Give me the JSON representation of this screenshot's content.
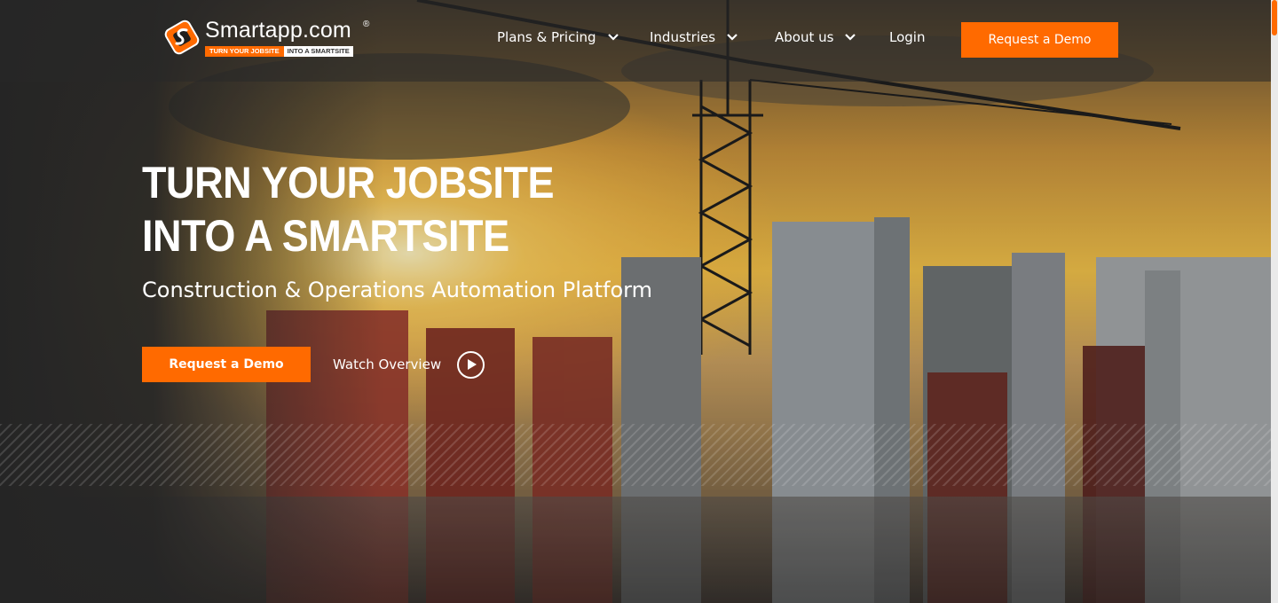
{
  "brand": {
    "name": "Smartapp.com",
    "registered": "®",
    "tagline_left": "TURN YOUR JOBSITE",
    "tagline_right": "INTO A SMARTSITE",
    "accent": "#ff6a00"
  },
  "nav": {
    "items": [
      {
        "label": "Plans & Pricing",
        "icon": "chevron-down-icon"
      },
      {
        "label": "Industries",
        "icon": "chevron-down-icon"
      },
      {
        "label": "About us",
        "icon": "chevron-down-icon"
      }
    ],
    "login": "Login",
    "cta": "Request a Demo"
  },
  "hero": {
    "title_line1": "TURN YOUR JOBSITE",
    "title_line2": "INTO A SMARTSITE",
    "subtitle": "Construction & Operations Automation Platform",
    "cta": "Request a Demo",
    "watch": "Watch Overview",
    "watch_icon": "play-icon"
  }
}
